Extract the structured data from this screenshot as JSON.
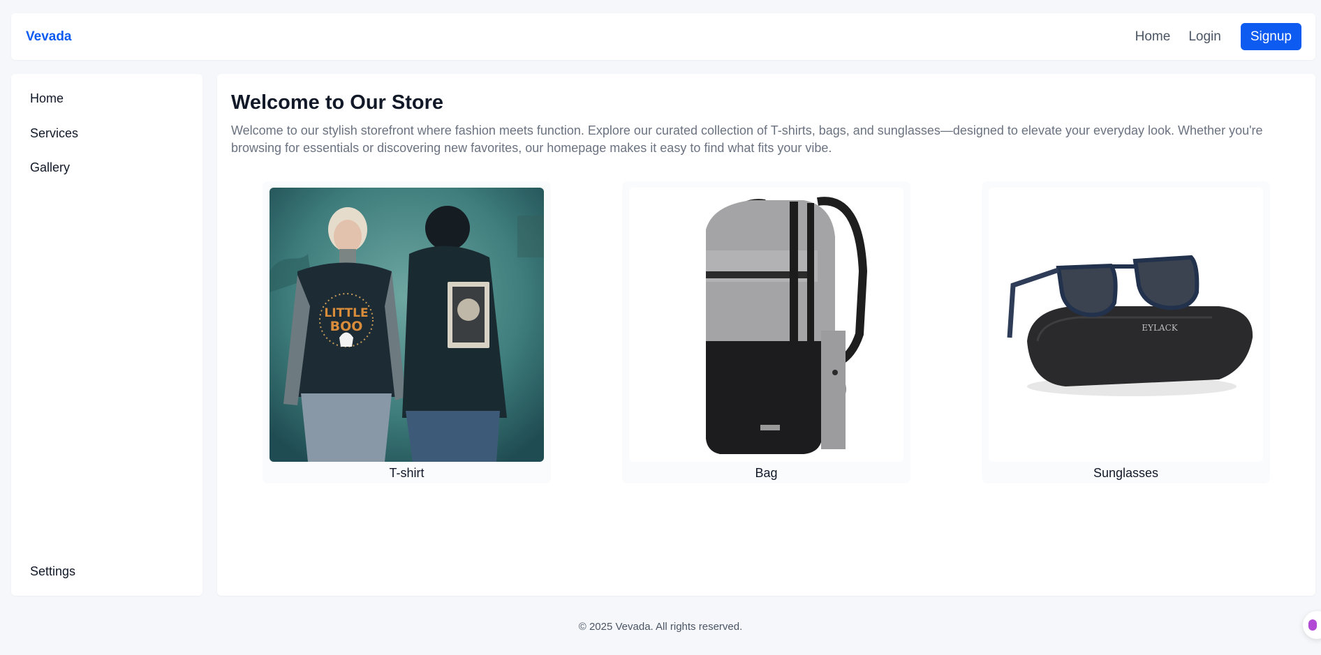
{
  "header": {
    "brand": "Vevada",
    "nav": [
      "Home",
      "Login"
    ],
    "signup": "Signup"
  },
  "sidebar": {
    "items": [
      "Home",
      "Services",
      "Gallery"
    ],
    "bottom": "Settings"
  },
  "main": {
    "title": "Welcome to Our Store",
    "intro": "Welcome to our stylish storefront where fashion meets function. Explore our curated collection of T-shirts, bags, and sunglasses—designed to elevate your everyday look. Whether you're browsing for essentials or discovering new favorites, our homepage makes it easy to find what fits your vibe.",
    "products": [
      {
        "label": "T-shirt",
        "icon": "tshirt-photo"
      },
      {
        "label": "Bag",
        "icon": "backpack-photo"
      },
      {
        "label": "Sunglasses",
        "icon": "sunglasses-photo"
      }
    ],
    "printed": {
      "shirt_text_1": "LITTLE",
      "shirt_text_2": "BOO",
      "case_logo": "EYLACK"
    }
  },
  "footer": {
    "copyright": "© 2025 Vevada. All rights reserved."
  },
  "colors": {
    "accent": "#0d5bf0",
    "background": "#f5f7fb",
    "muted_text": "#6b7280"
  }
}
